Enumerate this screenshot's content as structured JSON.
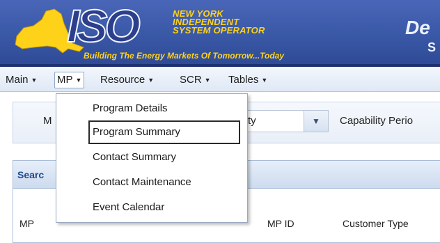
{
  "banner": {
    "org_line1": "NEW YORK",
    "org_line2": "INDEPENDENT",
    "org_line3": "SYSTEM OPERATOR",
    "logo_text": "ISO",
    "tagline": "Building The Energy Markets Of Tomorrow...Today",
    "right_text_1": "De",
    "right_text_2": "S"
  },
  "menu": {
    "items": [
      {
        "label": "Main"
      },
      {
        "label": "MP"
      },
      {
        "label": "Resource"
      },
      {
        "label": "SCR"
      },
      {
        "label": "Tables"
      }
    ],
    "active": "MP"
  },
  "dropdown": {
    "items": [
      {
        "label": "Program Details"
      },
      {
        "label": "Program Summary"
      },
      {
        "label": "Contact Summary"
      },
      {
        "label": "Contact Maintenance"
      },
      {
        "label": "Event Calendar"
      }
    ],
    "highlighted": "Program Summary"
  },
  "filters": {
    "left_label_fragment": "M",
    "select_value_fragment": "ty",
    "capability_label": "Capability Perio"
  },
  "search": {
    "title": "Searc",
    "columns": [
      "MP",
      "MP ID",
      "Customer Type"
    ]
  },
  "colors": {
    "banner_blue": "#3b5aa8",
    "banner_gold": "#ffd21a",
    "menu_bg": "#dfe8f5"
  }
}
